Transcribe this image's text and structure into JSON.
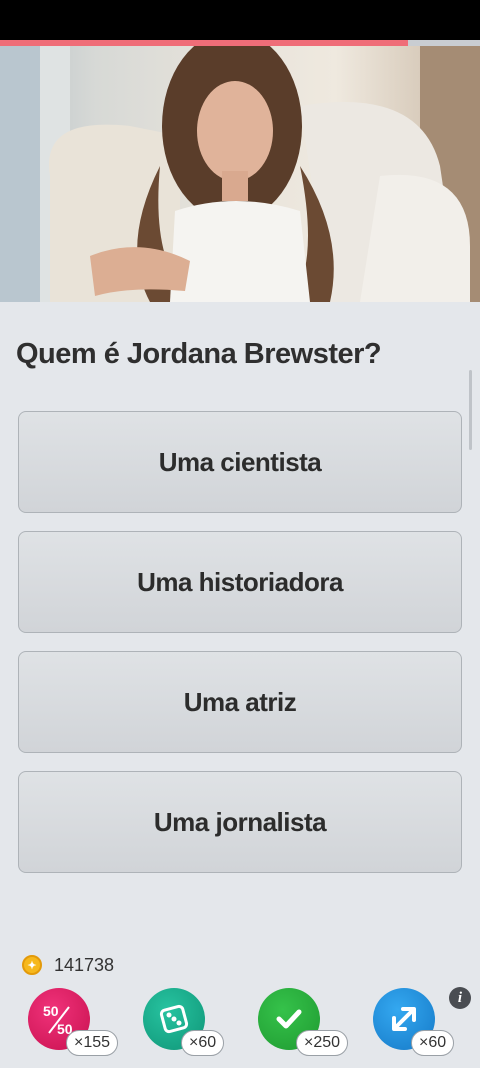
{
  "progress": {
    "fraction": 0.85,
    "fill_color": "#ef6d78"
  },
  "question": {
    "text": "Quem é Jordana Brewster?"
  },
  "answers": [
    {
      "label": "Uma cientista"
    },
    {
      "label": "Uma historiadora"
    },
    {
      "label": "Uma atriz"
    },
    {
      "label": "Uma jornalista"
    }
  ],
  "coins": {
    "icon": "coin-icon",
    "count": "141738"
  },
  "powerups": [
    {
      "name": "fifty-fifty",
      "icon": "fifty-fifty-icon",
      "count": "×155",
      "color": "#d81b5f"
    },
    {
      "name": "dice",
      "icon": "dice-icon",
      "count": "×60",
      "color": "#17a887"
    },
    {
      "name": "correct-answer",
      "icon": "check-icon",
      "count": "×250",
      "color": "#28ab3b"
    },
    {
      "name": "swap-question",
      "icon": "swap-icon",
      "count": "×60",
      "color": "#1f8bdb"
    }
  ],
  "info": {
    "icon": "info-icon",
    "glyph": "i"
  }
}
